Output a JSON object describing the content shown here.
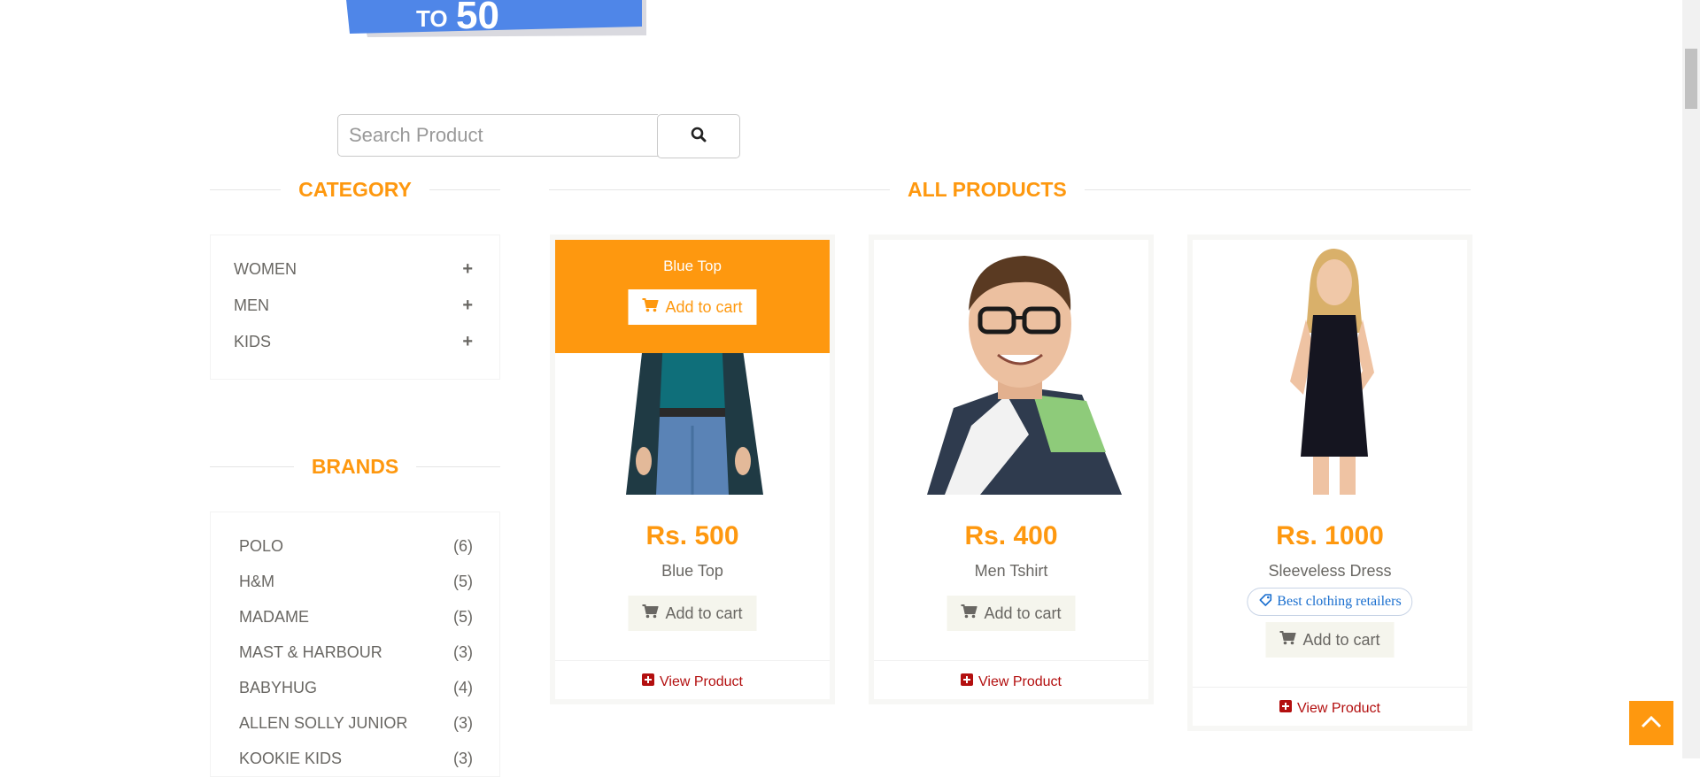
{
  "search": {
    "placeholder": "Search Product"
  },
  "category": {
    "title": "CATEGORY",
    "items": [
      {
        "label": "WOMEN"
      },
      {
        "label": "MEN"
      },
      {
        "label": "KIDS"
      }
    ]
  },
  "brands": {
    "title": "BRANDS",
    "items": [
      {
        "label": "POLO",
        "count": "(6)"
      },
      {
        "label": "H&M",
        "count": "(5)"
      },
      {
        "label": "MADAME",
        "count": "(5)"
      },
      {
        "label": "MAST & HARBOUR",
        "count": "(3)"
      },
      {
        "label": "BABYHUG",
        "count": "(4)"
      },
      {
        "label": "ALLEN SOLLY JUNIOR",
        "count": "(3)"
      },
      {
        "label": "KOOKIE KIDS",
        "count": "(3)"
      }
    ]
  },
  "products": {
    "title": "ALL PRODUCTS",
    "add_to_cart_label": "Add to cart",
    "view_product_label": "View Product",
    "items": [
      {
        "name": "Blue Top",
        "price": "Rs. 500",
        "hover": true
      },
      {
        "name": "Men Tshirt",
        "price": "Rs. 400"
      },
      {
        "name": "Sleeveless Dress",
        "price": "Rs. 1000",
        "badge": "Best clothing retailers"
      }
    ]
  },
  "colors": {
    "accent": "#fe980f",
    "link": "#b30f0f",
    "text": "#696763"
  },
  "icons": [
    "search-icon",
    "plus-icon",
    "cart-icon",
    "plus-square-icon",
    "tag-icon",
    "chevron-up-icon"
  ]
}
